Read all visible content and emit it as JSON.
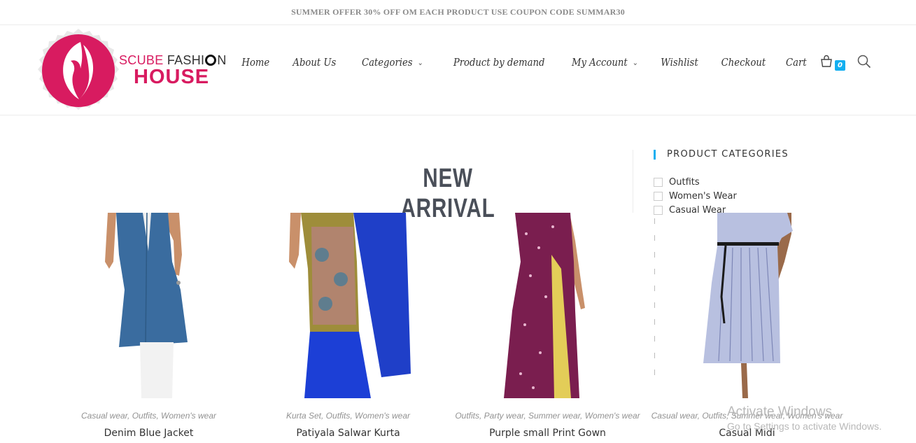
{
  "topbar": {
    "text": "SUMMER OFFER 30% OFF OM EACH PRODUCT USE COUPON CODE SUMMAR30"
  },
  "logo": {
    "line1_a": "SCUBE",
    "line1_b": "FASHI",
    "line1_c": "N",
    "line2": "HOUSE"
  },
  "nav": {
    "items": [
      "Home",
      "About Us",
      "Categories",
      "Product by demand",
      "My Account",
      "Wishlist",
      "Checkout",
      "Cart"
    ],
    "cart_count": "0"
  },
  "main": {
    "title": "NEW ARRIVAL"
  },
  "sidebar": {
    "title": "PRODUCT CATEGORIES",
    "categories": [
      "Outfits",
      "Women's Wear",
      "Casual Wear"
    ]
  },
  "products": [
    {
      "cats": "Casual wear, Outfits, Women's wear",
      "name": "Denim Blue Jacket"
    },
    {
      "cats": "Kurta Set, Outfits, Women's wear",
      "name": "Patiyala Salwar Kurta"
    },
    {
      "cats": "Outfits, Party wear, Summer wear, Women's wear",
      "name": "Purple small Print Gown"
    },
    {
      "cats": "Casual wear, Outfits, Summer wear, Women's wear",
      "name": "Casual Midi"
    }
  ],
  "watermark": {
    "line1": "Activate Windows",
    "line2": "Go to Settings to activate Windows."
  },
  "colors": {
    "accent": "#13aff0",
    "brand": "#d81b60"
  }
}
